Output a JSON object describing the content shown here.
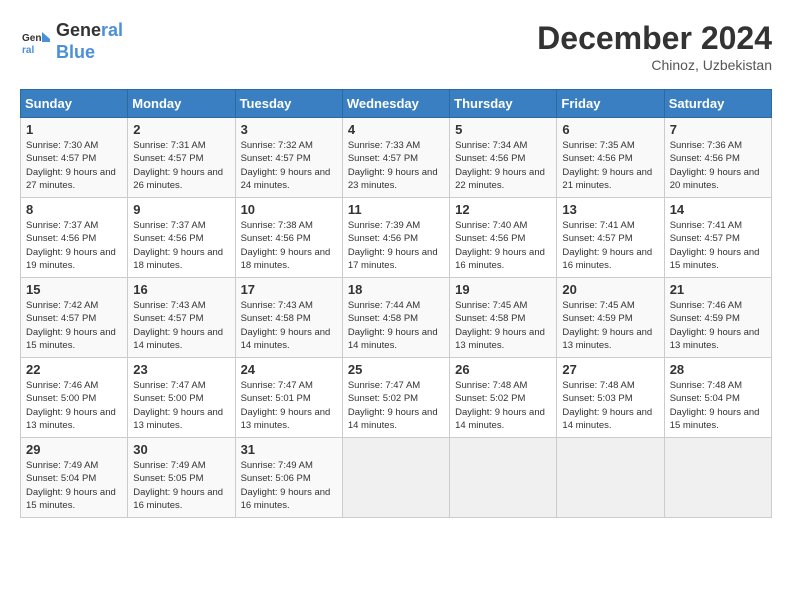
{
  "header": {
    "logo_line1": "General",
    "logo_line2": "Blue",
    "month": "December 2024",
    "location": "Chinoz, Uzbekistan"
  },
  "weekdays": [
    "Sunday",
    "Monday",
    "Tuesday",
    "Wednesday",
    "Thursday",
    "Friday",
    "Saturday"
  ],
  "weeks": [
    [
      {
        "day": "1",
        "sunrise": "Sunrise: 7:30 AM",
        "sunset": "Sunset: 4:57 PM",
        "daylight": "Daylight: 9 hours and 27 minutes."
      },
      {
        "day": "2",
        "sunrise": "Sunrise: 7:31 AM",
        "sunset": "Sunset: 4:57 PM",
        "daylight": "Daylight: 9 hours and 26 minutes."
      },
      {
        "day": "3",
        "sunrise": "Sunrise: 7:32 AM",
        "sunset": "Sunset: 4:57 PM",
        "daylight": "Daylight: 9 hours and 24 minutes."
      },
      {
        "day": "4",
        "sunrise": "Sunrise: 7:33 AM",
        "sunset": "Sunset: 4:57 PM",
        "daylight": "Daylight: 9 hours and 23 minutes."
      },
      {
        "day": "5",
        "sunrise": "Sunrise: 7:34 AM",
        "sunset": "Sunset: 4:56 PM",
        "daylight": "Daylight: 9 hours and 22 minutes."
      },
      {
        "day": "6",
        "sunrise": "Sunrise: 7:35 AM",
        "sunset": "Sunset: 4:56 PM",
        "daylight": "Daylight: 9 hours and 21 minutes."
      },
      {
        "day": "7",
        "sunrise": "Sunrise: 7:36 AM",
        "sunset": "Sunset: 4:56 PM",
        "daylight": "Daylight: 9 hours and 20 minutes."
      }
    ],
    [
      {
        "day": "8",
        "sunrise": "Sunrise: 7:37 AM",
        "sunset": "Sunset: 4:56 PM",
        "daylight": "Daylight: 9 hours and 19 minutes."
      },
      {
        "day": "9",
        "sunrise": "Sunrise: 7:37 AM",
        "sunset": "Sunset: 4:56 PM",
        "daylight": "Daylight: 9 hours and 18 minutes."
      },
      {
        "day": "10",
        "sunrise": "Sunrise: 7:38 AM",
        "sunset": "Sunset: 4:56 PM",
        "daylight": "Daylight: 9 hours and 18 minutes."
      },
      {
        "day": "11",
        "sunrise": "Sunrise: 7:39 AM",
        "sunset": "Sunset: 4:56 PM",
        "daylight": "Daylight: 9 hours and 17 minutes."
      },
      {
        "day": "12",
        "sunrise": "Sunrise: 7:40 AM",
        "sunset": "Sunset: 4:56 PM",
        "daylight": "Daylight: 9 hours and 16 minutes."
      },
      {
        "day": "13",
        "sunrise": "Sunrise: 7:41 AM",
        "sunset": "Sunset: 4:57 PM",
        "daylight": "Daylight: 9 hours and 16 minutes."
      },
      {
        "day": "14",
        "sunrise": "Sunrise: 7:41 AM",
        "sunset": "Sunset: 4:57 PM",
        "daylight": "Daylight: 9 hours and 15 minutes."
      }
    ],
    [
      {
        "day": "15",
        "sunrise": "Sunrise: 7:42 AM",
        "sunset": "Sunset: 4:57 PM",
        "daylight": "Daylight: 9 hours and 15 minutes."
      },
      {
        "day": "16",
        "sunrise": "Sunrise: 7:43 AM",
        "sunset": "Sunset: 4:57 PM",
        "daylight": "Daylight: 9 hours and 14 minutes."
      },
      {
        "day": "17",
        "sunrise": "Sunrise: 7:43 AM",
        "sunset": "Sunset: 4:58 PM",
        "daylight": "Daylight: 9 hours and 14 minutes."
      },
      {
        "day": "18",
        "sunrise": "Sunrise: 7:44 AM",
        "sunset": "Sunset: 4:58 PM",
        "daylight": "Daylight: 9 hours and 14 minutes."
      },
      {
        "day": "19",
        "sunrise": "Sunrise: 7:45 AM",
        "sunset": "Sunset: 4:58 PM",
        "daylight": "Daylight: 9 hours and 13 minutes."
      },
      {
        "day": "20",
        "sunrise": "Sunrise: 7:45 AM",
        "sunset": "Sunset: 4:59 PM",
        "daylight": "Daylight: 9 hours and 13 minutes."
      },
      {
        "day": "21",
        "sunrise": "Sunrise: 7:46 AM",
        "sunset": "Sunset: 4:59 PM",
        "daylight": "Daylight: 9 hours and 13 minutes."
      }
    ],
    [
      {
        "day": "22",
        "sunrise": "Sunrise: 7:46 AM",
        "sunset": "Sunset: 5:00 PM",
        "daylight": "Daylight: 9 hours and 13 minutes."
      },
      {
        "day": "23",
        "sunrise": "Sunrise: 7:47 AM",
        "sunset": "Sunset: 5:00 PM",
        "daylight": "Daylight: 9 hours and 13 minutes."
      },
      {
        "day": "24",
        "sunrise": "Sunrise: 7:47 AM",
        "sunset": "Sunset: 5:01 PM",
        "daylight": "Daylight: 9 hours and 13 minutes."
      },
      {
        "day": "25",
        "sunrise": "Sunrise: 7:47 AM",
        "sunset": "Sunset: 5:02 PM",
        "daylight": "Daylight: 9 hours and 14 minutes."
      },
      {
        "day": "26",
        "sunrise": "Sunrise: 7:48 AM",
        "sunset": "Sunset: 5:02 PM",
        "daylight": "Daylight: 9 hours and 14 minutes."
      },
      {
        "day": "27",
        "sunrise": "Sunrise: 7:48 AM",
        "sunset": "Sunset: 5:03 PM",
        "daylight": "Daylight: 9 hours and 14 minutes."
      },
      {
        "day": "28",
        "sunrise": "Sunrise: 7:48 AM",
        "sunset": "Sunset: 5:04 PM",
        "daylight": "Daylight: 9 hours and 15 minutes."
      }
    ],
    [
      {
        "day": "29",
        "sunrise": "Sunrise: 7:49 AM",
        "sunset": "Sunset: 5:04 PM",
        "daylight": "Daylight: 9 hours and 15 minutes."
      },
      {
        "day": "30",
        "sunrise": "Sunrise: 7:49 AM",
        "sunset": "Sunset: 5:05 PM",
        "daylight": "Daylight: 9 hours and 16 minutes."
      },
      {
        "day": "31",
        "sunrise": "Sunrise: 7:49 AM",
        "sunset": "Sunset: 5:06 PM",
        "daylight": "Daylight: 9 hours and 16 minutes."
      },
      null,
      null,
      null,
      null
    ]
  ]
}
